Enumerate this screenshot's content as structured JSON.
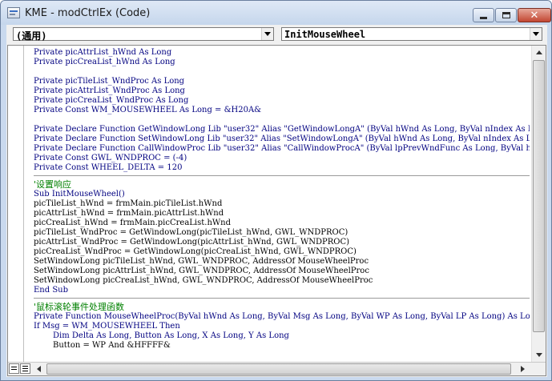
{
  "window": {
    "title": "KME - modCtrlEx (Code)",
    "close_glyph": "✕"
  },
  "object_combo": {
    "value": "(通用)"
  },
  "procedure_combo": {
    "value": "InitMouseWheel"
  },
  "code": {
    "declarations": [
      {
        "text": "Private picAttrList_hWnd As Long",
        "style": "kw"
      },
      {
        "text": "Private picCreaList_hWnd As Long",
        "style": "kw"
      },
      {
        "text": "",
        "style": "plain"
      },
      {
        "text": "Private picTileList_WndProc As Long",
        "style": "kw"
      },
      {
        "text": "Private picAttrList_WndProc As Long",
        "style": "kw"
      },
      {
        "text": "Private picCreaList_WndProc As Long",
        "style": "kw"
      },
      {
        "text": "Private Const WM_MOUSEWHEEL As Long = &H20A&",
        "style": "kw"
      },
      {
        "text": "",
        "style": "plain"
      },
      {
        "text": "Private Declare Function GetWindowLong Lib \"user32\" Alias \"GetWindowLongA\" (ByVal hWnd As Long, ByVal nIndex As Long) As Long",
        "style": "kw"
      },
      {
        "text": "Private Declare Function SetWindowLong Lib \"user32\" Alias \"SetWindowLongA\" (ByVal hWnd As Long, ByVal nIndex As Long, ByVal dwNewLong As Long) As Long",
        "style": "kw"
      },
      {
        "text": "Private Declare Function CallWindowProc Lib \"user32\" Alias \"CallWindowProcA\" (ByVal lpPrevWndFunc As Long, ByVal hWnd As Long) As Long",
        "style": "kw"
      },
      {
        "text": "Private Const GWL_WNDPROC = (-4)",
        "style": "kw"
      },
      {
        "text": "Private Const WHEEL_DELTA = 120",
        "style": "kw"
      }
    ],
    "init_proc": [
      {
        "text": "'设置响应",
        "style": "comment"
      },
      {
        "text": "Sub InitMouseWheel()",
        "style": "kw"
      },
      {
        "text": "picTileList_hWnd = frmMain.picTileList.hWnd",
        "style": "plain"
      },
      {
        "text": "picAttrList_hWnd = frmMain.picAttrList.hWnd",
        "style": "plain"
      },
      {
        "text": "picCreaList_hWnd = frmMain.picCreaList.hWnd",
        "style": "plain"
      },
      {
        "text": "picTileList_WndProc = GetWindowLong(picTileList_hWnd, GWL_WNDPROC)",
        "style": "plain"
      },
      {
        "text": "picAttrList_WndProc = GetWindowLong(picAttrList_hWnd, GWL_WNDPROC)",
        "style": "plain"
      },
      {
        "text": "picCreaList_WndProc = GetWindowLong(picCreaList_hWnd, GWL_WNDPROC)",
        "style": "plain"
      },
      {
        "text": "SetWindowLong picTileList_hWnd, GWL_WNDPROC, AddressOf MouseWheelProc",
        "style": "plain"
      },
      {
        "text": "SetWindowLong picAttrList_hWnd, GWL_WNDPROC, AddressOf MouseWheelProc",
        "style": "plain"
      },
      {
        "text": "SetWindowLong picCreaList_hWnd, GWL_WNDPROC, AddressOf MouseWheelProc",
        "style": "plain"
      },
      {
        "text": "End Sub",
        "style": "kw"
      }
    ],
    "wheel_proc": [
      {
        "text": "'鼠标滚轮事件处理函数",
        "style": "comment"
      },
      {
        "text": "Private Function MouseWheelProc(ByVal hWnd As Long, ByVal Msg As Long, ByVal WP As Long, ByVal LP As Long) As Long",
        "style": "kw"
      },
      {
        "text": "If Msg = WM_MOUSEWHEEL Then",
        "style": "kw"
      },
      {
        "text": "Dim Delta As Long, Button As Long, X As Long, Y As Long",
        "style": "kw indent"
      },
      {
        "text": "Button = WP And &HFFFF&",
        "style": "plain indent"
      }
    ]
  },
  "icons": {
    "app": "vb-code-window-icon",
    "minimize": "minimize-icon",
    "maximize": "maximize-icon",
    "close": "close-icon"
  }
}
